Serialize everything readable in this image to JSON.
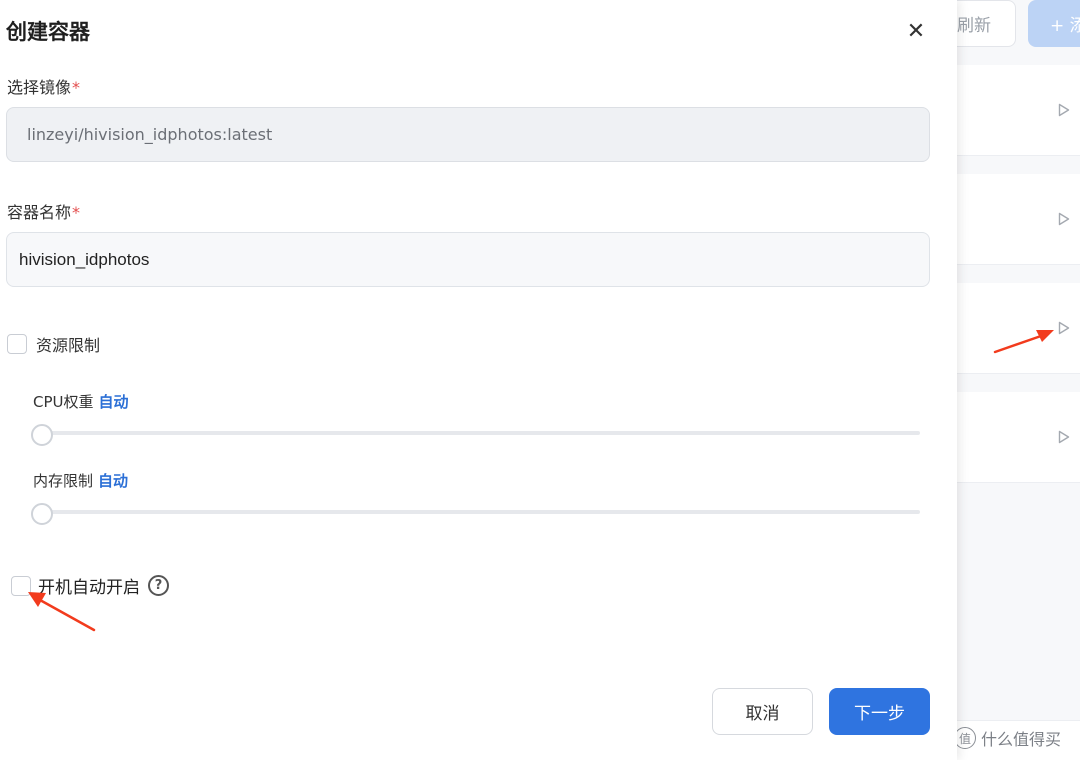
{
  "background": {
    "refresh_label": "刷新",
    "create_label": "+ 添",
    "row_icon": "play-triangle-icon"
  },
  "dialog": {
    "title": "创建容器",
    "close_icon": "close-icon",
    "image_field": {
      "label": "选择镜像",
      "required_mark": "*",
      "value": "linzeyi/hivision_idphotos:latest"
    },
    "name_field": {
      "label": "容器名称",
      "required_mark": "*",
      "value": "hivision_idphotos"
    },
    "resource_limit": {
      "label": "资源限制",
      "checked": false
    },
    "cpu": {
      "label": "CPU权重",
      "value_text": "自动",
      "level": 0
    },
    "memory": {
      "label": "内存限制",
      "value_text": "自动",
      "level": 0
    },
    "autostart": {
      "label": "开机自动开启",
      "checked": false,
      "help_icon": "question-circle-icon"
    },
    "buttons": {
      "cancel": "取消",
      "next": "下一步"
    }
  },
  "watermark": {
    "text": "什么值得买",
    "icon": "zhi-logo-icon"
  },
  "colors": {
    "primary": "#2f74e0",
    "auto_text": "#2b6fd6",
    "required": "#e34d4d",
    "annotation_arrow": "#f23b1d"
  }
}
